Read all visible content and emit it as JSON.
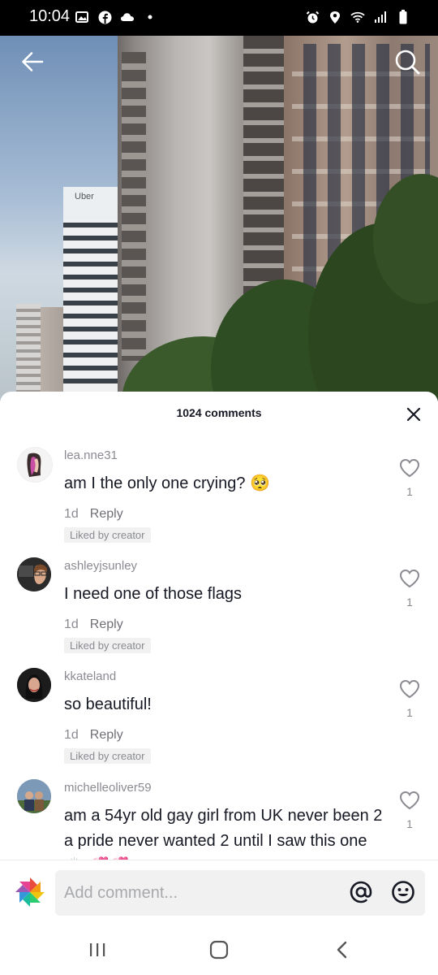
{
  "status_bar": {
    "time": "10:04",
    "left_icons": [
      "gallery-icon",
      "facebook-icon",
      "cloud-icon",
      "dot-icon"
    ],
    "right_icons": [
      "alarm-icon",
      "location-icon",
      "wifi-icon",
      "signal-icon",
      "battery-icon"
    ]
  },
  "video": {
    "sign_text": "Uber"
  },
  "top_bar": {
    "back_icon": "arrow-left-icon",
    "search_icon": "search-icon"
  },
  "comments_panel": {
    "title": "1024 comments",
    "close_icon": "close-icon",
    "comments": [
      {
        "username": "lea.nne31",
        "text": "am I the only one crying? 🥺",
        "time": "1d",
        "reply_label": "Reply",
        "liked_label": "Liked by creator",
        "likes": "1"
      },
      {
        "username": "ashleyjsunley",
        "text": "I need one of those flags",
        "time": "1d",
        "reply_label": "Reply",
        "liked_label": "Liked by creator",
        "likes": "1"
      },
      {
        "username": "kkateland",
        "text": "so beautiful!",
        "time": "1d",
        "reply_label": "Reply",
        "liked_label": "Liked by creator",
        "likes": "1"
      },
      {
        "username": "michelleoliver59",
        "text": "am a 54yr old gay girl from UK never been 2 a pride never wanted 2 until I saw this one 🙌🏻 💞💞",
        "likes": "1"
      }
    ]
  },
  "composer": {
    "placeholder": "Add comment...",
    "mention_icon": "at-sign-icon",
    "emoji_icon": "emoji-icon"
  },
  "nav_bar": {
    "icons": [
      "recent-apps-icon",
      "home-icon",
      "back-icon"
    ]
  }
}
